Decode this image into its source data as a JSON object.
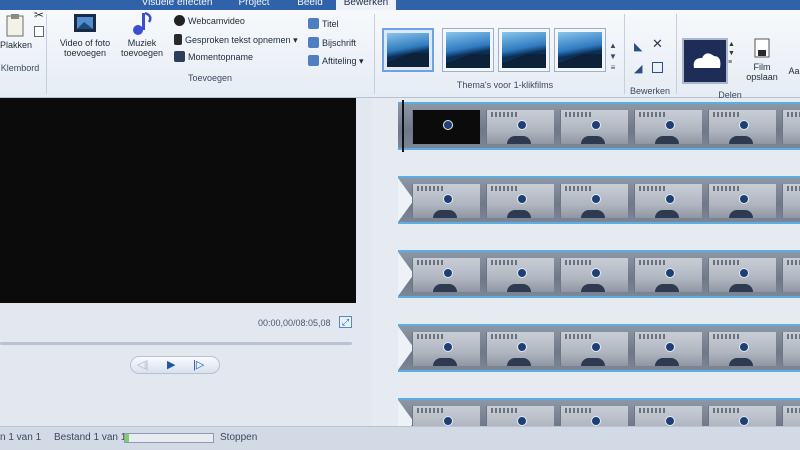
{
  "tabs": [
    "Visuele effecten",
    "Project",
    "Beeld",
    "Bewerken"
  ],
  "active_tab": "Bewerken",
  "ribbon": {
    "clipboard": {
      "paste_label": "Plakken",
      "group_label": "Klembord"
    },
    "add": {
      "video_photo_label_1": "Video of foto",
      "video_photo_label_2": "toevoegen",
      "music_label_1": "Muziek",
      "music_label_2": "toevoegen",
      "webcam": "Webcamvideo",
      "narration": "Gesproken tekst opnemen",
      "snapshot": "Momentopname",
      "title": "Titel",
      "caption": "Bijschrift",
      "credits": "Aftiteling",
      "group_label": "Toevoegen"
    },
    "themes": {
      "group_label": "Thema's voor 1-klikfilms"
    },
    "edit": {
      "group_label": "Bewerken"
    },
    "share": {
      "save_movie_1": "Film",
      "save_movie_2": "opslaan",
      "group_label": "Delen",
      "more": "Aa"
    }
  },
  "preview": {
    "timecode": "00:00,00/08:05,08"
  },
  "statusbar": {
    "item_count": "n 1 van 1",
    "file_count": "Bestand 1 van 1",
    "stop_label": "Stoppen",
    "progress": 0.05
  },
  "colors": {
    "ribbon_tab_bg": "#2f62a8",
    "strip_border": "#5aaee2",
    "accent": "#1d58a8"
  },
  "icons": [
    "cut-icon",
    "copy-icon",
    "film-add-icon",
    "music-note-icon",
    "webcam-icon",
    "microphone-icon",
    "snapshot-icon",
    "title-icon",
    "caption-icon",
    "credits-icon",
    "rotate-icon",
    "delete-icon",
    "onedrive-icon",
    "save-movie-icon",
    "expand-icon",
    "play-icon",
    "previous-frame-icon",
    "next-frame-icon",
    "clock-icon"
  ]
}
